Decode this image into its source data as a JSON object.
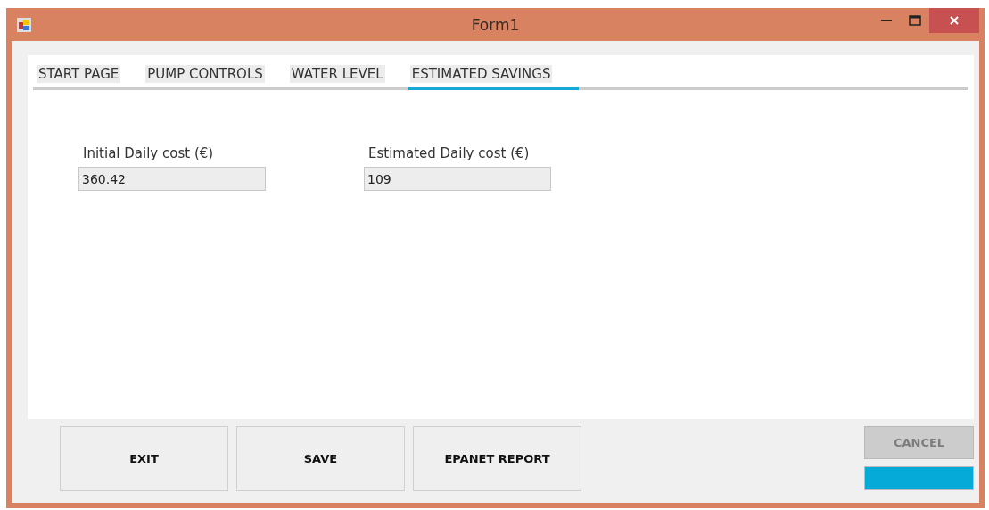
{
  "window": {
    "title": "Form1"
  },
  "tabs": [
    {
      "label": "START PAGE",
      "selected": false
    },
    {
      "label": "PUMP CONTROLS",
      "selected": false
    },
    {
      "label": "WATER LEVEL",
      "selected": false
    },
    {
      "label": "ESTIMATED SAVINGS",
      "selected": true
    }
  ],
  "fields": [
    {
      "label": "Initial Daily cost (€)",
      "value": "360.42"
    },
    {
      "label": "Estimated Daily cost (€)",
      "value": "109"
    }
  ],
  "buttons": [
    {
      "label": "EXIT"
    },
    {
      "label": "SAVE"
    },
    {
      "label": "EPANET REPORT"
    }
  ],
  "cancel": {
    "label": "CANCEL",
    "disabled": true
  },
  "progress": {
    "level": 1
  }
}
